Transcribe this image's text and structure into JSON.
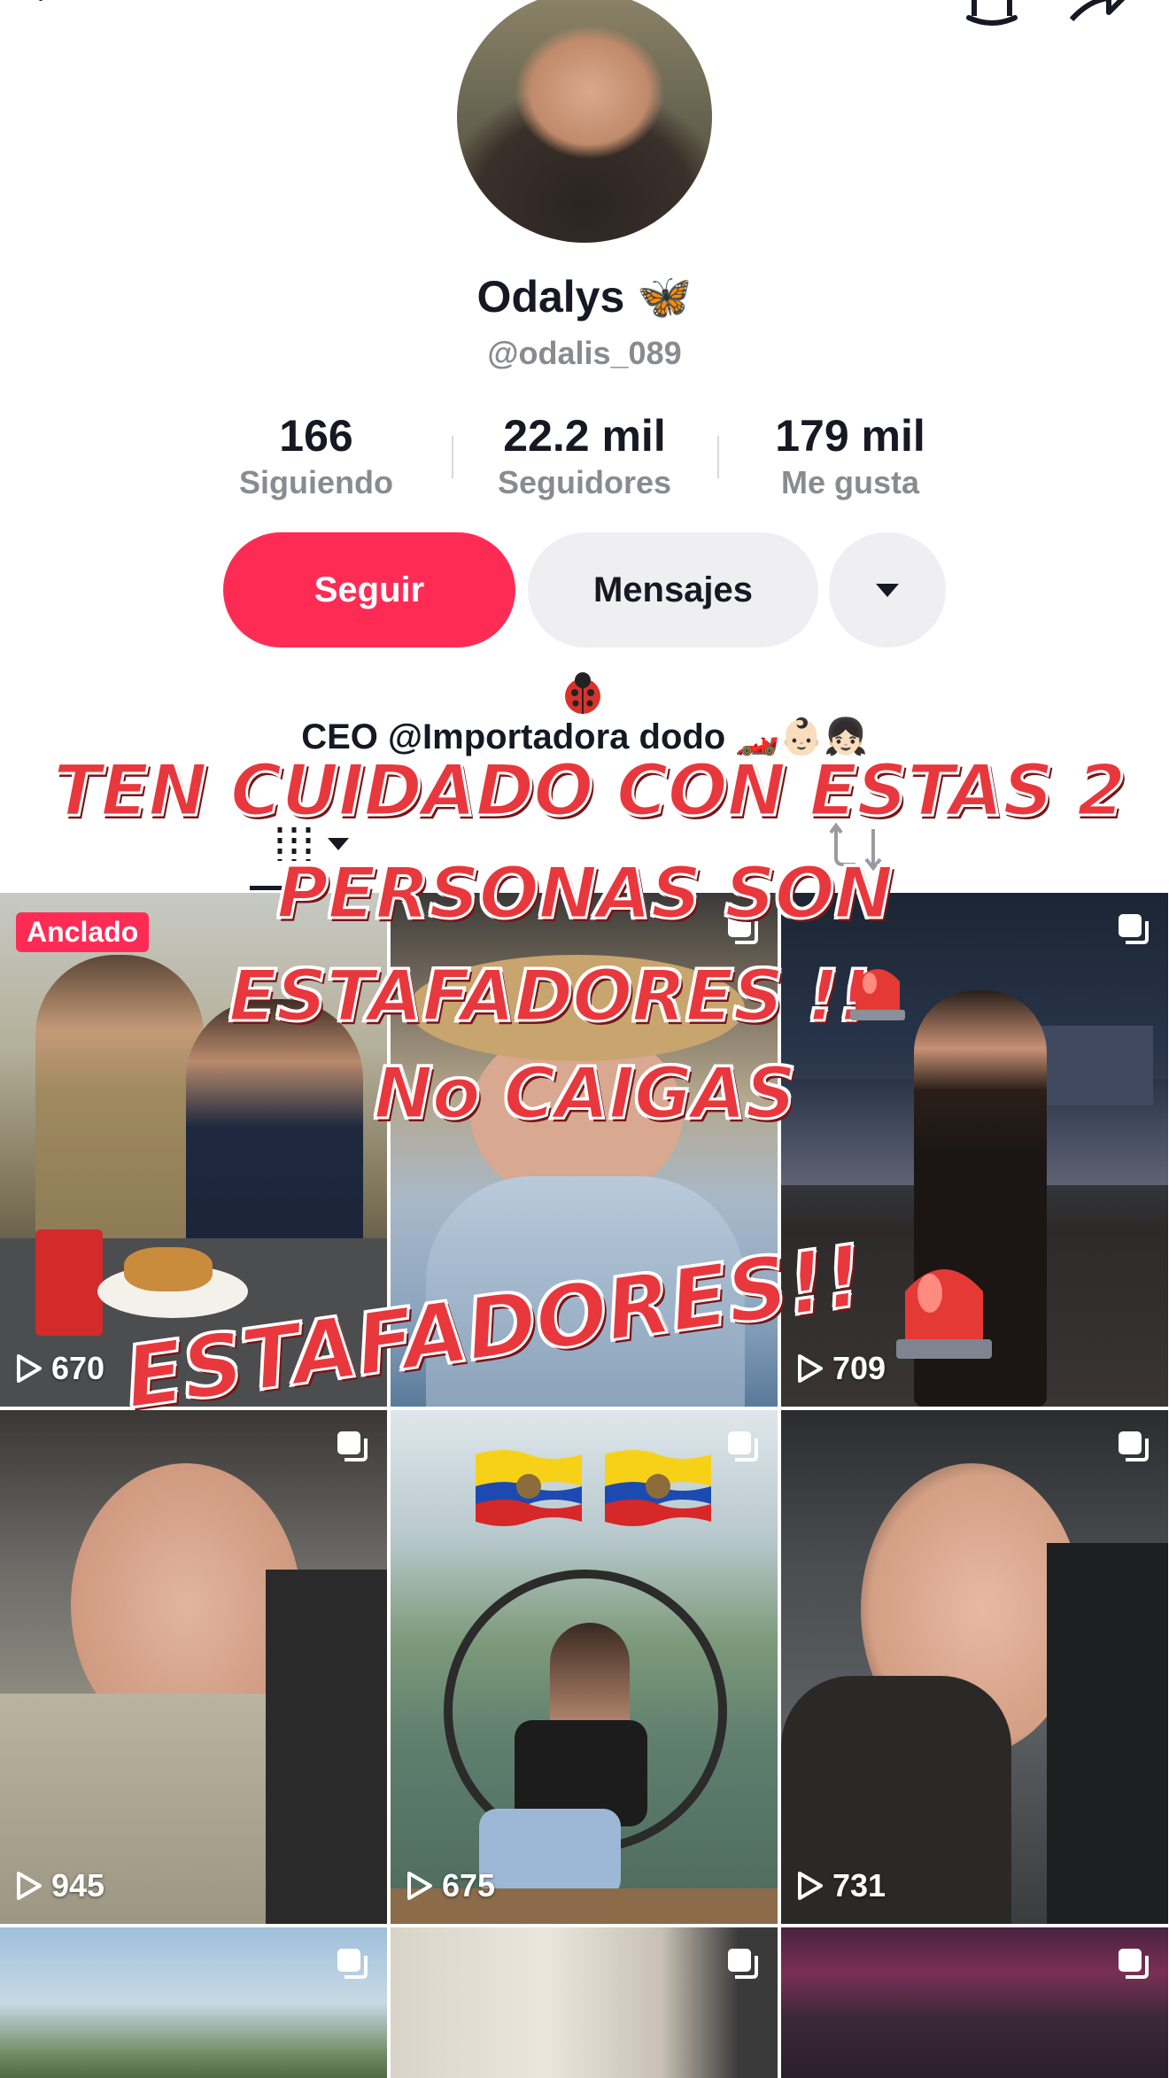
{
  "profile": {
    "display_name": "Odalys 🦋",
    "username": "@odalis_089",
    "bio": "CEO @Importadora dodo 🏎️👶🏻👧🏻"
  },
  "stats": [
    {
      "value": "166",
      "label": "Siguiendo"
    },
    {
      "value": "22.2 mil",
      "label": "Seguidores"
    },
    {
      "value": "179 mil",
      "label": "Me gusta"
    }
  ],
  "actions": {
    "follow_label": "Seguir",
    "message_label": "Mensajes"
  },
  "overlay_text": {
    "line1": "TEN CUIDADO CON ESTAS 2",
    "line2": "PERSONAS SON",
    "line3": "ESTAFADORES !!",
    "line4": "No CAIGAS",
    "big": "ESTAFADORES!!"
  },
  "videos": [
    {
      "views": "670",
      "pinned_label": "Anclado"
    },
    {
      "views": ""
    },
    {
      "views": "709"
    },
    {
      "views": "945"
    },
    {
      "views": "675"
    },
    {
      "views": "731"
    },
    {
      "views": ""
    },
    {
      "views": ""
    },
    {
      "views": ""
    }
  ],
  "colors": {
    "accent": "#fe2c55",
    "overlay_red": "#e8383d"
  },
  "icons": [
    "back-icon",
    "bell-icon",
    "share-icon",
    "ladybug-icon",
    "video-grid-icon",
    "repost-icon",
    "play-icon",
    "carousel-icon",
    "siren-icon",
    "ecuador-flag-icon"
  ]
}
